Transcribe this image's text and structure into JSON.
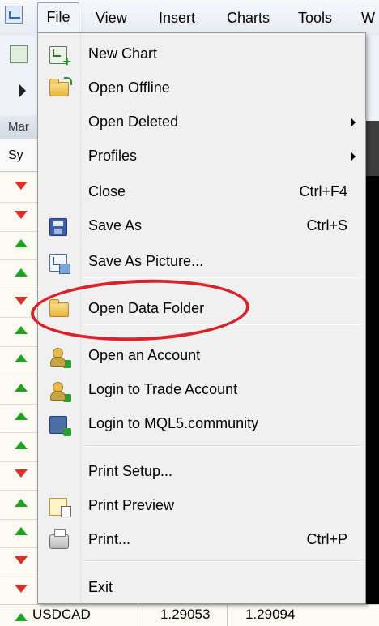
{
  "menubar": {
    "items": [
      {
        "label": "File",
        "name": "menu-file"
      },
      {
        "label": "View",
        "name": "menu-view"
      },
      {
        "label": "Insert",
        "name": "menu-insert"
      },
      {
        "label": "Charts",
        "name": "menu-charts"
      },
      {
        "label": "Tools",
        "name": "menu-tools"
      },
      {
        "label": "W",
        "name": "menu-window"
      }
    ]
  },
  "background": {
    "panel_header": "Mar",
    "column_header": "Sy",
    "row_arrows": [
      "down",
      "down",
      "up",
      "up",
      "down",
      "up",
      "up",
      "up",
      "up",
      "up",
      "down",
      "up",
      "up",
      "down",
      "down"
    ],
    "bottom_row": {
      "symbol": "USDCAD",
      "bid": "1.29053",
      "ask": "1.29094",
      "arrow": "up"
    }
  },
  "file_menu": {
    "items": [
      {
        "label": "New Chart",
        "icon": "new-chart-icon",
        "shortcut": "",
        "submenu": false
      },
      {
        "label": "Open Offline",
        "icon": "open-folder-icon",
        "shortcut": "",
        "submenu": false
      },
      {
        "label": "Open Deleted",
        "icon": "",
        "shortcut": "",
        "submenu": true
      },
      {
        "label": "Profiles",
        "icon": "",
        "shortcut": "",
        "submenu": true
      },
      {
        "label": "Close",
        "icon": "",
        "shortcut": "Ctrl+F4",
        "submenu": false
      },
      {
        "label": "Save As",
        "icon": "save-icon",
        "shortcut": "Ctrl+S",
        "submenu": false
      },
      {
        "label": "Save As Picture...",
        "icon": "picture-icon",
        "shortcut": "",
        "submenu": false
      },
      {
        "label": "Open Data Folder",
        "icon": "folder-icon",
        "shortcut": "",
        "submenu": false,
        "highlighted": true
      },
      {
        "label": "Open an Account",
        "icon": "open-account-icon",
        "shortcut": "",
        "submenu": false
      },
      {
        "label": "Login to Trade Account",
        "icon": "login-account-icon",
        "shortcut": "",
        "submenu": false
      },
      {
        "label": "Login to MQL5.community",
        "icon": "mql5-icon",
        "shortcut": "",
        "submenu": false
      },
      {
        "label": "Print Setup...",
        "icon": "",
        "shortcut": "",
        "submenu": false
      },
      {
        "label": "Print Preview",
        "icon": "print-preview-icon",
        "shortcut": "",
        "submenu": false
      },
      {
        "label": "Print...",
        "icon": "printer-icon",
        "shortcut": "Ctrl+P",
        "submenu": false
      },
      {
        "label": "Exit",
        "icon": "",
        "shortcut": "",
        "submenu": false
      }
    ]
  },
  "annotation": {
    "color": "#d8232a",
    "target": "Open Data Folder"
  }
}
